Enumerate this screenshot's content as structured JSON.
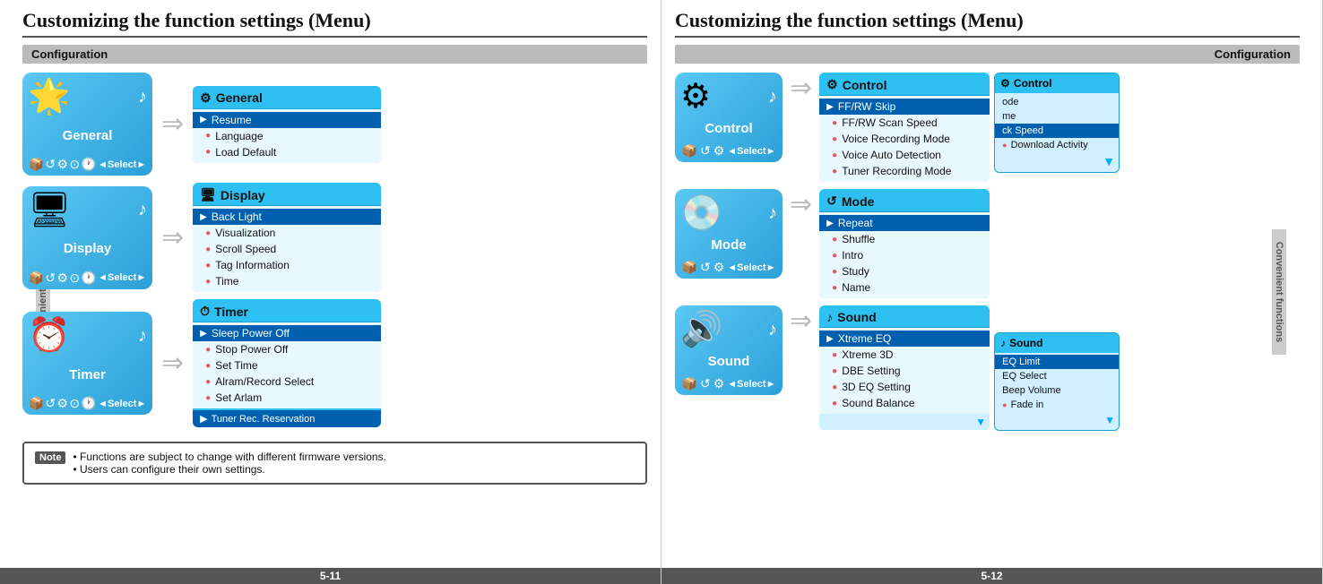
{
  "left": {
    "title": "Customizing the function settings (Menu)",
    "config_label": "Configuration",
    "side_label": "Convenient functions",
    "page_number": "5-11",
    "sections": [
      {
        "id": "general",
        "device_label": "General",
        "device_emoji": "🌟",
        "menu_title": "General",
        "menu_title_icon": "⚙",
        "menu_items": [
          {
            "text": "Resume",
            "type": "selected"
          },
          {
            "text": "Language",
            "type": "bullet"
          },
          {
            "text": "Load Default",
            "type": "bullet"
          }
        ]
      },
      {
        "id": "display",
        "device_label": "Display",
        "device_emoji": "🖥",
        "menu_title": "Display",
        "menu_title_icon": "🖥",
        "menu_items": [
          {
            "text": "Back Light",
            "type": "selected"
          },
          {
            "text": "Visualization",
            "type": "bullet"
          },
          {
            "text": "Scroll Speed",
            "type": "bullet"
          },
          {
            "text": "Tag Information",
            "type": "bullet"
          },
          {
            "text": "Time",
            "type": "bullet"
          }
        ]
      },
      {
        "id": "timer",
        "device_label": "Timer",
        "device_emoji": "⏰",
        "menu_title": "Timer",
        "menu_title_icon": "⏱",
        "menu_items": [
          {
            "text": "Sleep Power Off",
            "type": "selected"
          },
          {
            "text": "Stop Power Off",
            "type": "bullet"
          },
          {
            "text": "Set Time",
            "type": "bullet"
          },
          {
            "text": "Alram/Record Select",
            "type": "bullet"
          },
          {
            "text": "Set Arlam",
            "type": "bullet"
          }
        ],
        "extra_item": "Tuner Rec. Reservation"
      }
    ],
    "note": {
      "label": "Note",
      "lines": [
        "• Functions are subject to change with different firmware versions.",
        "• Users can configure their own settings."
      ]
    }
  },
  "right": {
    "title": "Customizing the function settings (Menu)",
    "config_label": "Configuration",
    "side_label": "Convenient functions",
    "page_number": "5-12",
    "sections": [
      {
        "id": "control",
        "device_label": "Control",
        "device_emoji": "⚙",
        "menu_title": "Control",
        "menu_title_icon": "⚙",
        "menu_items": [
          {
            "text": "FF/RW Skip",
            "type": "selected"
          },
          {
            "text": "FF/RW Scan Speed",
            "type": "bullet"
          },
          {
            "text": "Voice Recording Mode",
            "type": "bullet"
          },
          {
            "text": "Voice Auto Detection",
            "type": "bullet"
          },
          {
            "text": "Tuner Recording Mode",
            "type": "bullet"
          }
        ],
        "ext_panel": {
          "title": "Control",
          "title_icon": "⚙",
          "items": [
            {
              "text": "ode",
              "type": "normal"
            },
            {
              "text": "me",
              "type": "normal"
            },
            {
              "text": "ck Speed",
              "type": "highlighted"
            },
            {
              "text": "Download Activity",
              "type": "bullet"
            }
          ]
        }
      },
      {
        "id": "mode",
        "device_label": "Mode",
        "device_emoji": "💿",
        "menu_title": "Mode",
        "menu_title_icon": "↺",
        "menu_items": [
          {
            "text": "Repeat",
            "type": "selected"
          },
          {
            "text": "Shuffle",
            "type": "bullet"
          },
          {
            "text": "Intro",
            "type": "bullet"
          },
          {
            "text": "Study",
            "type": "bullet"
          },
          {
            "text": "Name",
            "type": "bullet"
          }
        ]
      },
      {
        "id": "sound",
        "device_label": "Sound",
        "device_emoji": "🔊",
        "menu_title": "Sound",
        "menu_title_icon": "♪",
        "menu_items": [
          {
            "text": "Xtreme EQ",
            "type": "selected"
          },
          {
            "text": "Xtreme 3D",
            "type": "bullet"
          },
          {
            "text": "DBE Setting",
            "type": "bullet"
          },
          {
            "text": "3D EQ Setting",
            "type": "bullet"
          },
          {
            "text": "Sound Balance",
            "type": "bullet"
          }
        ],
        "ext_panel": {
          "title": "Sound",
          "title_icon": "♪",
          "items": [
            {
              "text": "EQ Limit",
              "type": "highlighted"
            },
            {
              "text": "EQ Select",
              "type": "normal"
            },
            {
              "text": "Beep Volume",
              "type": "normal"
            },
            {
              "text": "• Fade in",
              "type": "normal"
            }
          ]
        }
      }
    ]
  }
}
